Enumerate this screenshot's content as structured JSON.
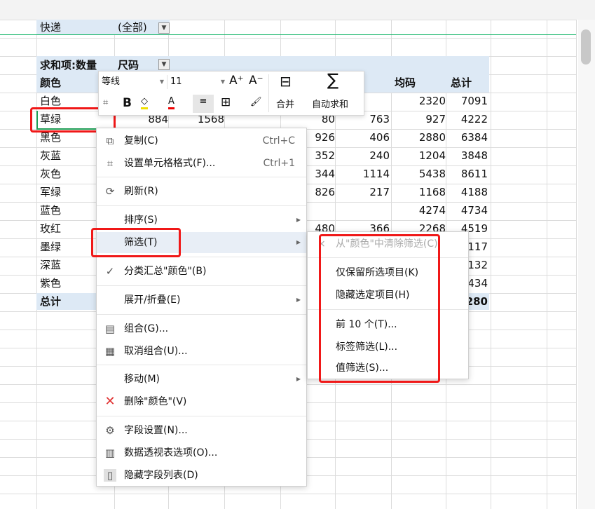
{
  "pivot": {
    "filter_label": "快递",
    "filter_value": "(全部)",
    "value_label": "求和项:数量",
    "col_field": "尺码",
    "row_header": "颜色",
    "col_headers": {
      "avg": "均码",
      "total": "总计"
    },
    "rows": [
      {
        "name": "白色",
        "vals": [
          "",
          "",
          "",
          "",
          "2320",
          "7091"
        ]
      },
      {
        "name": "草绿",
        "lead": [
          "884",
          "1568"
        ],
        "vals": [
          "80",
          "763",
          "927",
          "4222"
        ]
      },
      {
        "name": "黑色",
        "vals": [
          "926",
          "406",
          "2880",
          "6384"
        ]
      },
      {
        "name": "灰蓝",
        "vals": [
          "352",
          "240",
          "1204",
          "3848"
        ]
      },
      {
        "name": "灰色",
        "vals": [
          "344",
          "1114",
          "5438",
          "8611"
        ]
      },
      {
        "name": "军绿",
        "vals": [
          "826",
          "217",
          "1168",
          "4188"
        ]
      },
      {
        "name": "蓝色",
        "vals": [
          "",
          "",
          "4274",
          "4734"
        ]
      },
      {
        "name": "玫红",
        "vals": [
          "480",
          "366",
          "2268",
          "4519"
        ]
      },
      {
        "name": "墨绿",
        "vals": [
          "",
          "",
          "",
          "117"
        ]
      },
      {
        "name": "深蓝",
        "vals": [
          "",
          "",
          "",
          "132"
        ]
      },
      {
        "name": "紫色",
        "vals": [
          "",
          "",
          "",
          "434"
        ]
      }
    ],
    "total_label": "总计",
    "total_value": "280"
  },
  "toolbar": {
    "font": "等线",
    "size": "11",
    "grow": "A⁺",
    "shrink": "A⁻",
    "merge": "合并",
    "autosum": "自动求和",
    "bold": "B",
    "color_a": "A"
  },
  "menu": {
    "copy": "复制(C)",
    "copy_sc": "Ctrl+C",
    "format": "设置单元格格式(F)...",
    "format_sc": "Ctrl+1",
    "refresh": "刷新(R)",
    "sort": "排序(S)",
    "filter": "筛选(T)",
    "subtotal": "分类汇总\"颜色\"(B)",
    "expand": "展开/折叠(E)",
    "group": "组合(G)...",
    "ungroup": "取消组合(U)...",
    "move": "移动(M)",
    "delete": "删除\"颜色\"(V)",
    "field_settings": "字段设置(N)...",
    "pivot_options": "数据透视表选项(O)...",
    "hide_field_list": "隐藏字段列表(D)"
  },
  "submenu": {
    "clear": "从\"颜色\"中清除筛选(C)",
    "keep": "仅保留所选项目(K)",
    "hide": "隐藏选定项目(H)",
    "top10": "前 10 个(T)...",
    "label_filter": "标签筛选(L)...",
    "value_filter": "值筛选(S)..."
  },
  "colors": {
    "accent": "#1fb86f",
    "highlight": "#f01818",
    "band": "#dde9f5"
  }
}
